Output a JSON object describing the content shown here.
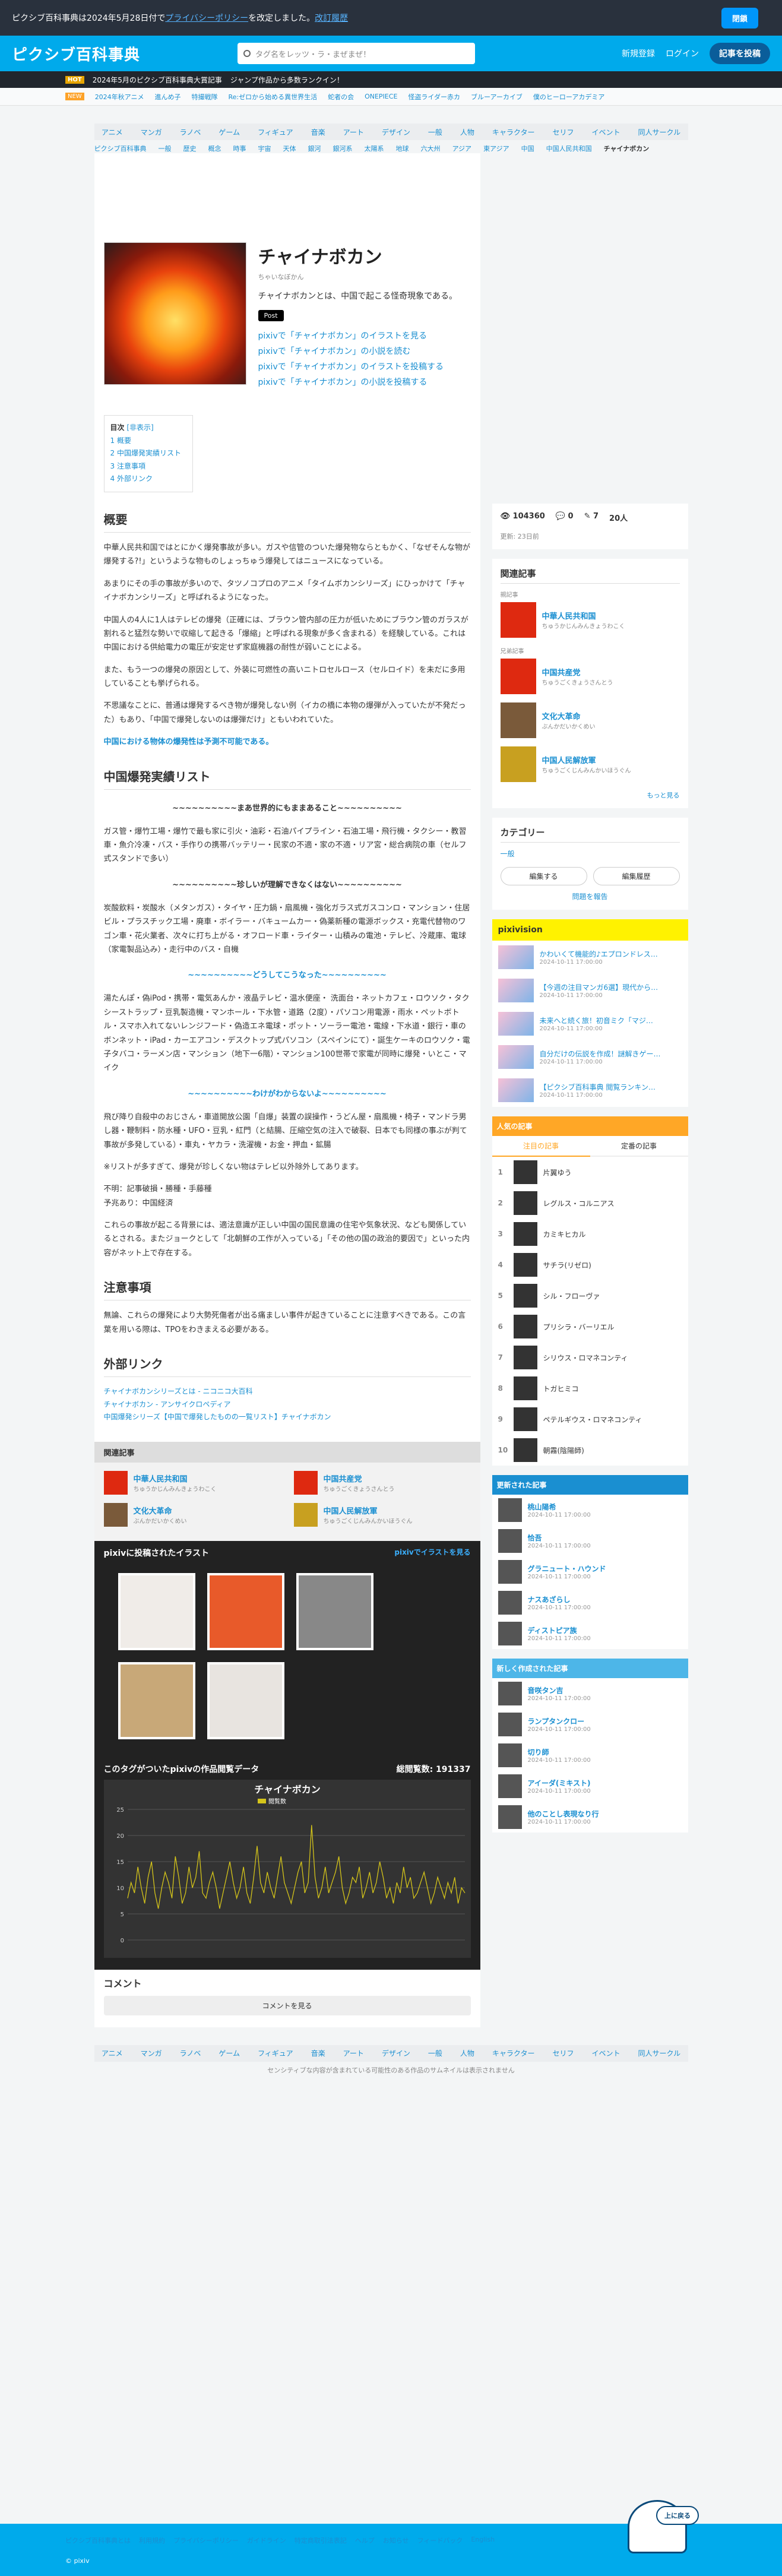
{
  "notice": {
    "text": "ピクシブ百科事典は2024年5月28日付で",
    "link": "プライバシーポリシー",
    "text2": "を改定しました。",
    "link2": "改訂履歴",
    "close_label": "閉鎖"
  },
  "header": {
    "logo": "ピクシブ百科事典",
    "search_placeholder": "タグ名をレッツ・ラ・まぜまぜ！",
    "register": "新規登録",
    "login": "ログイン",
    "create": "記事を投稿"
  },
  "banner": {
    "badge": "HOT",
    "text1": "2024年5月のピクシブ百科事典大賞記事",
    "text2": "ジャンプ作品から多数ランクイン！"
  },
  "banner2": {
    "badge": "NEW",
    "items": [
      "2024年秋アニメ",
      "進んめ子",
      "特撮戦隊",
      "Re:ゼロから始める異世界生活",
      "蛇者の会",
      "ONEPIECE",
      "怪盗ライダー赤カ",
      "ブルーアーカイブ",
      "僕のヒーローアカデミア"
    ]
  },
  "catbar": [
    "アニメ",
    "マンガ",
    "ラノベ",
    "ゲーム",
    "フィギュア",
    "音楽",
    "アート",
    "デザイン",
    "一般",
    "人物",
    "キャラクター",
    "セリフ",
    "イベント",
    "同人サークル"
  ],
  "subcat": [
    "ピクシブ百科事典",
    "一般",
    "歴史",
    "概念",
    "時事",
    "宇宙",
    "天体",
    "銀河",
    "銀河系",
    "太陽系",
    "地球",
    "六大州",
    "アジア",
    "東アジア",
    "中国",
    "中国人民共和国",
    "チャイナボカン"
  ],
  "article": {
    "title": "チャイナボカン",
    "kana": "ちゃいなぼかん",
    "desc": "チャイナボカンとは、中国で起こる怪奇現象である。",
    "post": "Post",
    "pixiv_links": [
      "pixivで「チャイナボカン」のイラストを見る",
      "pixivで「チャイナボカン」の小説を読む",
      "pixivで「チャイナボカン」のイラストを投稿する",
      "pixivで「チャイナボカン」の小説を投稿する"
    ]
  },
  "toc": {
    "title": "目次",
    "toggle": "[非表示]",
    "items": [
      "1 概要",
      "2 中国爆発実績リスト",
      "3 注意事項",
      "4 外部リンク"
    ]
  },
  "sections": {
    "overview_title": "概要",
    "overview_p1": "中華人民共和国ではとにかく爆発事故が多い。ガスや信管のついた爆発物ならともかく、「なぜそんな物が爆発する?!」というような物ものしょっちゅう爆発してはニュースになっている。",
    "overview_p2": "あまりにその手の事故が多いので、タツノコプロのアニメ「タイムボカンシリーズ」にひっかけて「チャイナボカンシリーズ」と呼ばれるようになった。",
    "overview_p3": "中国人の4人に1人はテレビの爆発（正確には、ブラウン管内部の圧力が低いためにブラウン管のガラスが割れると猛烈な勢いで収縮して起きる「爆縮」と呼ばれる現象が多く含まれる）を経験している。これは中国における供給電力の電圧が安定せず家庭機器の耐性が弱いことによる。",
    "overview_p4": "また、もう一つの爆発の原因として、外装に可燃性の高いニトロセルロース（セルロイド）を未だに多用していることも挙げられる。",
    "overview_p5": "不思議なことに、普通は爆発するべき物が爆発しない例（イカの橋に本物の爆弾が入っていたが不発だった）もあり、「中国で爆発しないのは爆弾だけ」ともいわれていた。",
    "overview_p6": "中国における物体の爆発性は予測不可能である。",
    "list_title": "中国爆発実績リスト",
    "h_sudden": "~~~~~~~~~~まあ世界的にもままあること~~~~~~~~~~",
    "p_sudden": "ガス管・爆竹工場・爆竹で最も家に引火・油彩・石油パイプライン・石油工場・飛行機・タクシー・教習車・魚介冷凍・バス・手作りの携帯バッテリー・民家の不適・家の不適・リア宮・総合病院の車（セルフ式スタンドで多い）",
    "h_weird": "~~~~~~~~~~珍しいが理解できなくはない~~~~~~~~~~",
    "p_weird": "炭酸飲料・炭酸水（メタンガス）・タイヤ・圧力鍋・扇風機・強化ガラス式ガスコンロ・マンション・住居ビル・プラスチック工場・廃車・ボイラー・バキュームカー・偽薬新種の電源ボックス・充電代替物のワゴン車・花火業者、次々に打ち上がる・オフロード車・ライター・山積みの電池・テレビ、冷蔵庫、電球（家電製品込み）・走行中のバス・自機",
    "h_how": "~~~~~~~~~~どうしてこうなった~~~~~~~~~~",
    "p_how": "湯たんぽ・偽iPod・携帯・電気あんか・液晶テレビ・温水便座・ 洗面台・ネットカフェ・ロウソク・タクシーストラップ・豆乳製造機・マンホール・下水管・道路（2度）・パソコン用電源・雨水・ペットボトル・スマホ入れてないレンジフード・偽造エネ電球・ポット・ソーラー電池・電線・下水道・銀行・車のボンネット・iPad・カーエアコン・デスクトップ式パソコン（スペインにて）・誕生ケーキのロウソク・電子タバコ・ラーメン店・マンション（地下一6階）・マンション100世帯で家電が同時に爆発・いとこ・マイク",
    "h_unknown": "~~~~~~~~~~わけがわからないよ~~~~~~~~~~",
    "p_unknown": "飛び降り自殺中のおじさん・車道開放公園「自爆」装置の誤操作・うどん屋・扇風機・椅子・マンドラ男し器・鞭制料・防水種・UFO・豆乳・紅門（と結腸、圧縮空気の注入で破裂、日本でも同様の事ぶが判て事故が多発している）・車丸・ヤカラ・洗濯機・お金・押血・鉱腸",
    "p_note": "※リストが多すぎて、爆発が珍しくない物はテレビ以外除外してあります。",
    "p_unknown2": "不明：記事破損・勝種・手藤種\n予兆あり：中国経済",
    "p_final": "これらの事故が起こる背景には、適法意識が正しい中国の国民意識の住宅や気象状況、なども関係しているとされる。またジョークとして「北朝鮮の工作が入っている」「その他の国の政治的要因で」といった内容がネット上で存在する。",
    "caution_title": "注意事項",
    "caution_p": "無論、これらの爆発により大勢死傷者が出る痛ましい事件が起きていることに注意すべきである。この言葉を用いる際は、TPOをわきまえる必要がある。",
    "links_title": "外部リンク",
    "links": [
      "チャイナボカンシリーズとは - ニコニコ大百科",
      "チャイナボカン - アンサイクロペディア",
      "中国爆発シリーズ【中国で爆発したものの一覧リスト】チャイナボカン"
    ]
  },
  "stats": {
    "views": "104360",
    "comments": "0",
    "edits": "7",
    "users": "20人",
    "updated": "更新: 23日前"
  },
  "side": {
    "related_title": "関連記事",
    "parent_label": "親記事",
    "parent": {
      "name": "中華人民共和国",
      "kana": "ちゅうかじんみんきょうわこく"
    },
    "siblings_label": "兄弟記事",
    "siblings": [
      {
        "name": "中国共産党",
        "kana": "ちゅうごくきょうさんとう"
      },
      {
        "name": "文化大革命",
        "kana": "ぶんかだいかくめい"
      },
      {
        "name": "中国人民解放軍",
        "kana": "ちゅうごくじんみんかいほうぐん"
      }
    ],
    "more": "もっと見る",
    "category_title": "カテゴリー",
    "category": "一般",
    "edit_btn": "編集する",
    "history_btn": "編集履歴",
    "report": "問題を報告"
  },
  "pixivision": {
    "title": "pixivision",
    "items": [
      {
        "title": "かわいくて機能的♪エプロンドレス…",
        "date": "2024-10-11 17:00:00"
      },
      {
        "title": "【今週の注目マンガ6選】現代から…",
        "date": "2024-10-11 17:00:00"
      },
      {
        "title": "未来へと続く旅！初音ミク「マジ…",
        "date": "2024-10-11 17:00:00"
      },
      {
        "title": "自分だけの伝説を作成！謎解きゲー…",
        "date": "2024-10-11 17:00:00"
      },
      {
        "title": "【ピクシブ百科事典 閲覧ランキン…",
        "date": "2024-10-11 17:00:00"
      }
    ]
  },
  "ranking": {
    "title": "人気の記事",
    "tab1": "注目の記事",
    "tab2": "定番の記事",
    "items": [
      "片翼ゆう",
      "レグルス・コルニアス",
      "カミキヒカル",
      "サチラ(リゼロ)",
      "シル・フローヴァ",
      "プリシラ・バーリエル",
      "シリウス・ロマネコンティ",
      "トガヒミコ",
      "ペテルギウス・ロマネコンティ",
      "朝霧(陰陽師)"
    ]
  },
  "recent": {
    "title": "更新された記事",
    "items": [
      {
        "name": "桃山陽希",
        "date": "2024-10-11 17:00:00"
      },
      {
        "name": "恰吾",
        "date": "2024-10-11 17:00:00"
      },
      {
        "name": "グラニュート・ハウンド",
        "date": "2024-10-11 17:00:00"
      },
      {
        "name": "ナスあざらし",
        "date": "2024-10-11 17:00:00"
      },
      {
        "name": "ディストピア族",
        "date": "2024-10-11 17:00:00"
      }
    ]
  },
  "newest": {
    "title": "新しく作成された記事",
    "items": [
      {
        "name": "音咲タン吉",
        "date": "2024-10-11 17:00:00"
      },
      {
        "name": "ランプタンクロー",
        "date": "2024-10-11 17:00:00"
      },
      {
        "name": "切り師",
        "date": "2024-10-11 17:00:00"
      },
      {
        "name": "アイーダ(ミキスト)",
        "date": "2024-10-11 17:00:00"
      },
      {
        "name": "他のことし表現なり行",
        "date": "2024-10-11 17:00:00"
      }
    ]
  },
  "illust": {
    "title": "pixivに投稿されたイラスト",
    "see_more": "pixivでイラストを見る"
  },
  "chart_title": "このタグがついたpixivの作品閲覧データ",
  "chart_total": "総閲覧数: 191337",
  "chart_data": {
    "type": "line",
    "title": "チャイナボカン",
    "legend": "閲覧数",
    "ylim": [
      0,
      25
    ],
    "yticks": [
      0,
      5,
      10,
      15,
      20,
      25
    ],
    "values": [
      8,
      11,
      9,
      14,
      10,
      7,
      12,
      15,
      9,
      6,
      10,
      13,
      11,
      8,
      16,
      12,
      7,
      9,
      14,
      10,
      12,
      17,
      9,
      8,
      11,
      13,
      10,
      6,
      9,
      12,
      15,
      11,
      8,
      10,
      14,
      9,
      7,
      12,
      18,
      11,
      9,
      13,
      10,
      8,
      12,
      16,
      11,
      9,
      7,
      10,
      13,
      15,
      9,
      11,
      22,
      12,
      8,
      10,
      14,
      9,
      11,
      13,
      16,
      10,
      7,
      9,
      12,
      11,
      14,
      8,
      10,
      13,
      9,
      11,
      15,
      12,
      8,
      10,
      7,
      11,
      9,
      14,
      10,
      12,
      8,
      9,
      11,
      13,
      10,
      7,
      9,
      12,
      10,
      8,
      11,
      9,
      12,
      7,
      10,
      9
    ]
  },
  "comment": {
    "title": "コメント",
    "button": "コメントを見る"
  },
  "footer": {
    "note": "センシティブな内容が含まれている可能性のある作品のサムネイルは表示されません",
    "links": [
      "ピクシブ百科事典とは",
      "利用規約",
      "プライバシーポリシー",
      "ガイドライン",
      "特定商取引法表記",
      "ヘルプ",
      "お知らせ",
      "フィードバック",
      "English"
    ],
    "copyright": "© pixiv",
    "gotop": "上に戻る"
  }
}
